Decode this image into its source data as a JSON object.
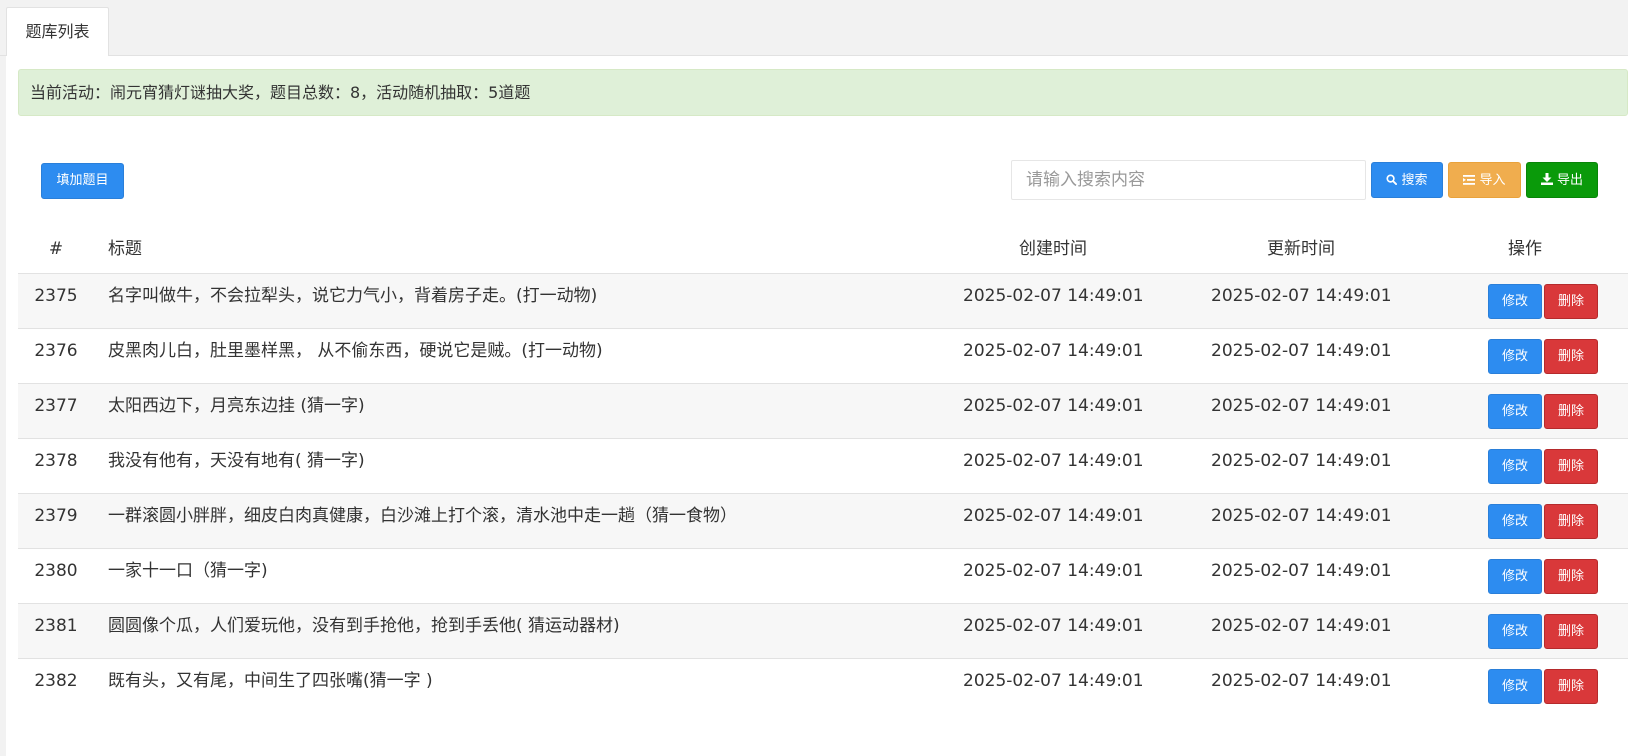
{
  "tab": {
    "label": "题库列表"
  },
  "alert": {
    "text": "当前活动：闹元宵猜灯谜抽大奖，题目总数：8，活动随机抽取：5道题"
  },
  "toolbar": {
    "add_label": "填加题目",
    "search_placeholder": "请输入搜索内容",
    "search_label": "搜索",
    "import_label": "导入",
    "export_label": "导出"
  },
  "icons": {
    "search": "search-icon",
    "import": "list-icon",
    "export": "download-icon"
  },
  "colors": {
    "primary": "#2d8cf0",
    "warning": "#f0ad4e",
    "success": "#0a9a0a",
    "danger": "#d9383a",
    "alert_bg": "#dff0d8"
  },
  "table": {
    "headers": {
      "id": "#",
      "title": "标题",
      "created": "创建时间",
      "updated": "更新时间",
      "operation": "操作"
    },
    "edit_label": "修改",
    "delete_label": "删除",
    "rows": [
      {
        "id": "2375",
        "title": "名字叫做牛，不会拉犁头，说它力气小，背着房子走。(打一动物)",
        "created": "2025-02-07 14:49:01",
        "updated": "2025-02-07 14:49:01"
      },
      {
        "id": "2376",
        "title": "皮黑肉儿白，肚里墨样黑， 从不偷东西，硬说它是贼。(打一动物)",
        "created": "2025-02-07 14:49:01",
        "updated": "2025-02-07 14:49:01"
      },
      {
        "id": "2377",
        "title": "太阳西边下，月亮东边挂 (猜一字)",
        "created": "2025-02-07 14:49:01",
        "updated": "2025-02-07 14:49:01"
      },
      {
        "id": "2378",
        "title": "我没有他有，天没有地有( 猜一字)",
        "created": "2025-02-07 14:49:01",
        "updated": "2025-02-07 14:49:01"
      },
      {
        "id": "2379",
        "title": "一群滚圆小胖胖，细皮白肉真健康，白沙滩上打个滚，清水池中走一趟（猜一食物）",
        "created": "2025-02-07 14:49:01",
        "updated": "2025-02-07 14:49:01"
      },
      {
        "id": "2380",
        "title": "一家十一口（猜一字)",
        "created": "2025-02-07 14:49:01",
        "updated": "2025-02-07 14:49:01"
      },
      {
        "id": "2381",
        "title": "圆圆像个瓜，人们爱玩他，没有到手抢他，抢到手丢他( 猜运动器材)",
        "created": "2025-02-07 14:49:01",
        "updated": "2025-02-07 14:49:01"
      },
      {
        "id": "2382",
        "title": "既有头，又有尾，中间生了四张嘴(猜一字 )",
        "created": "2025-02-07 14:49:01",
        "updated": "2025-02-07 14:49:01"
      }
    ]
  }
}
